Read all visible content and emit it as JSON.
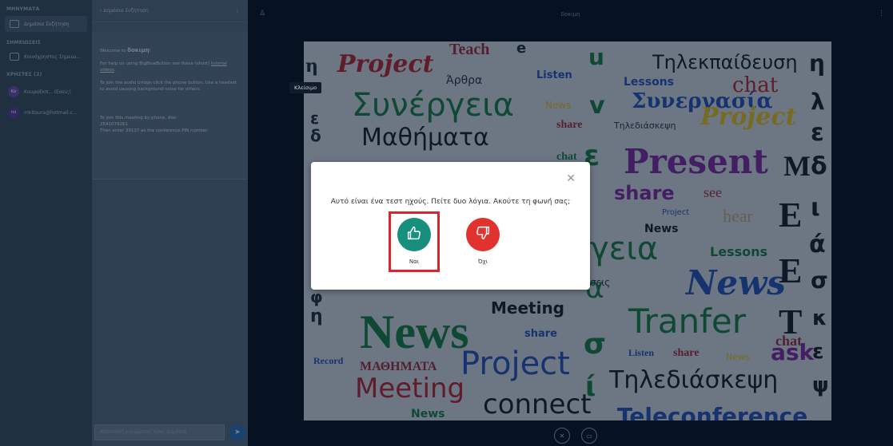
{
  "sidebar": {
    "messages_title": "ΜΗΝΥΜΑΤΑ",
    "public_chat_label": "Δημόσια Συζήτηση",
    "notes_title": "ΣΗΜΕΙΩΣΕΙΣ",
    "shared_notes_label": "Κοινόχρηστες Σημειώ...",
    "users_title": "ΧΡΗΣΤΕΣ (2)",
    "users": [
      {
        "initials": "Κα",
        "name": "ΚαυραΕκπ... (Εσείς)"
      },
      {
        "initials": "mi",
        "name": "mkitoura@hotmail.c..."
      }
    ]
  },
  "chat": {
    "header_title": "‹ Δημόσια Συζήτηση",
    "welcome_prefix": "Welcome to ",
    "welcome_room": "δοκιμη",
    "welcome_suffix": "!",
    "help_prefix": "For help on using BigBlueButton see these (short) ",
    "help_link": "tutorial videos",
    "help_suffix": ".",
    "audio_text": "To join the audio bridge click the phone button. Use a headset to avoid causing background noise for others.",
    "phone_text": "To join this meeting by phone, dial:",
    "phone_number": "2541079261",
    "pin_text": "Then enter 39137 as the conference PIN number.",
    "input_placeholder": "Αποστολή μηνύματος προς Δημόσια",
    "send_icon": "send-icon"
  },
  "main": {
    "title": "δοκιμη",
    "tooltip": "Κλείσιμο"
  },
  "modal": {
    "prompt": "Αυτό είναι ένα τεστ ηχούς. Πείτε δυο λόγια. Ακούτε τη φωνή σας;",
    "yes_label": "Ναι",
    "no_label": "Όχι",
    "accent_yes": "#16907c",
    "accent_no": "#e0322e",
    "highlight": "#d9252f"
  },
  "slide_words": {
    "project1": "Project",
    "arthra": "Άρθρα",
    "teach": "Teach",
    "listen": "Listen",
    "lessons1": "Lessons",
    "tilekpaideusi": "Τηλεκπαίδευση",
    "chat1": "chat",
    "synergeia": "Συνέργεια",
    "news1": "News",
    "synergasia": "Συνεργασία",
    "mathimata": "Μαθήματα",
    "share1": "share",
    "tilediaskepsi1": "Τηλεδιάσκεψη",
    "project2": "Project",
    "chat2": "chat",
    "present": "Present",
    "share2": "share",
    "see": "see",
    "project3": "Project",
    "hear": "hear",
    "news2": "News",
    "lessons2": "Lessons",
    "eia": "γεια",
    "seis": "σεις",
    "news3": "News",
    "meeting1": "Meeting",
    "news4": "News",
    "share3": "share",
    "tranfer": "Tranfer",
    "listen2": "Listen",
    "share4": "share",
    "news5": "News",
    "chat3": "chat",
    "ask": "ask",
    "record": "Record",
    "mathimata_caps": "ΜΑΘΗΜΑΤΑ",
    "project4": "Project",
    "tilediaskepsi2": "Τηλεδιάσκεψη",
    "meeting2": "Meeting",
    "connect": "connect",
    "news6": "News",
    "teleconference": "Teleconference"
  }
}
